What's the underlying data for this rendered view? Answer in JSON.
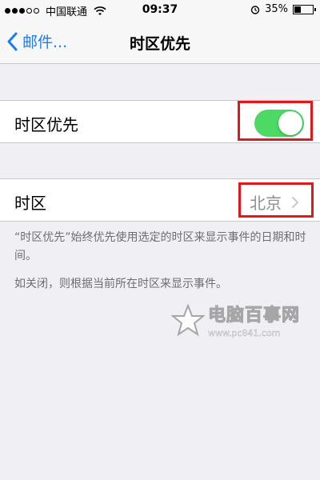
{
  "status_bar": {
    "carrier": "中国联通",
    "time": "09:37",
    "battery": "35%",
    "battery_level": 0.35,
    "icons": [
      "signal-dots",
      "wifi-icon",
      "alarm-icon",
      "battery-icon"
    ]
  },
  "nav": {
    "back_label": "邮件...",
    "title": "时区优先"
  },
  "settings": {
    "override_label": "时区优先",
    "override_on": true,
    "timezone_label": "时区",
    "timezone_value": "北京"
  },
  "footer": {
    "line1": "“时区优先”始终优先使用选定的时区来显示事件的日期和时间。",
    "line2": "如关闭，则根据当前所在时区来显示事件。"
  },
  "watermark": {
    "title": "电脑百事网",
    "url": "www.pc841.com"
  },
  "colors": {
    "accent": "#1a7cf5",
    "toggle_on": "#4cd964",
    "highlight": "#e1171c",
    "background": "#efeff4"
  }
}
